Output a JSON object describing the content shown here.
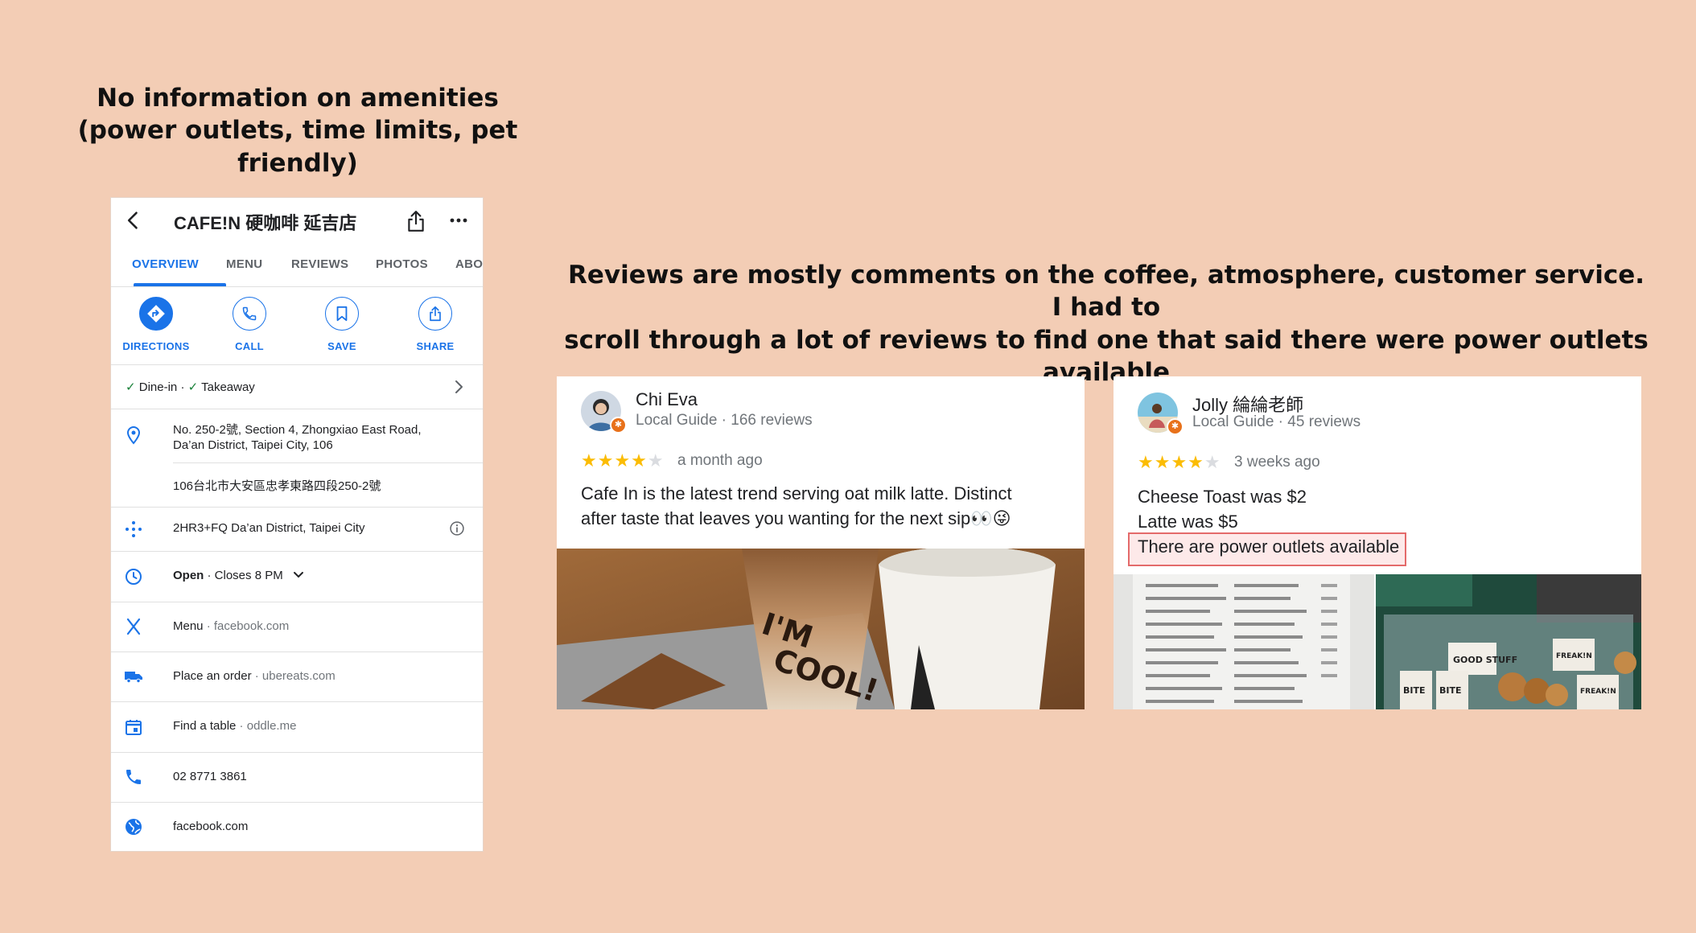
{
  "headings": {
    "left_line1": "No information on amenities",
    "left_line2": "(power outlets, time limits, pet friendly)",
    "right_line1": "Reviews are mostly comments on the coffee, atmosphere, customer service. I had to",
    "right_line2": "scroll through a lot of reviews to find one that said there were power outlets available"
  },
  "place": {
    "title": "CAFE!N 硬咖啡 延吉店",
    "tabs": [
      "OVERVIEW",
      "MENU",
      "REVIEWS",
      "PHOTOS",
      "ABO"
    ],
    "active_tab": "OVERVIEW",
    "actions": {
      "directions": "DIRECTIONS",
      "call": "CALL",
      "save": "SAVE",
      "share": "SHARE"
    },
    "service": {
      "dine_in": "Dine-in",
      "separator": " · ",
      "takeaway": "Takeaway"
    },
    "address_line1": "No. 250-2號, Section 4, Zhongxiao East Road,",
    "address_line2": "Da’an District, Taipei City, 106",
    "address_local": "106台北市大安區忠孝東路四段250-2號",
    "plus_code": "2HR3+FQ Da’an District, Taipei City",
    "hours_status": "Open",
    "hours_detail": " · Closes 8 PM",
    "menu_label": "Menu",
    "menu_link": " · facebook.com",
    "order_label": "Place an order",
    "order_link": " · ubereats.com",
    "table_label": "Find a table",
    "table_link": " · oddle.me",
    "phone": "02 8771 3861",
    "website": "facebook.com"
  },
  "reviews": [
    {
      "name": "Chi Eva",
      "meta": "Local Guide · 166 reviews",
      "rating": 4,
      "time": "a month ago",
      "text_line1": "Cafe In is the latest trend serving oat milk latte. Distinct",
      "text_line2": "after taste that leaves you wanting for the next sip👀😜"
    },
    {
      "name": "Jolly 綸綸老師",
      "meta": "Local Guide · 45 reviews",
      "rating": 4,
      "time": "3 weeks ago",
      "text_line1": "Cheese Toast was $2",
      "text_line2": "Latte was $5",
      "text_line3": "There are power outlets available"
    }
  ],
  "colors": {
    "background": "#f3cdb5",
    "accent": "#1a73e8",
    "star": "#fbbc04",
    "highlight_border": "#e46a6a"
  }
}
